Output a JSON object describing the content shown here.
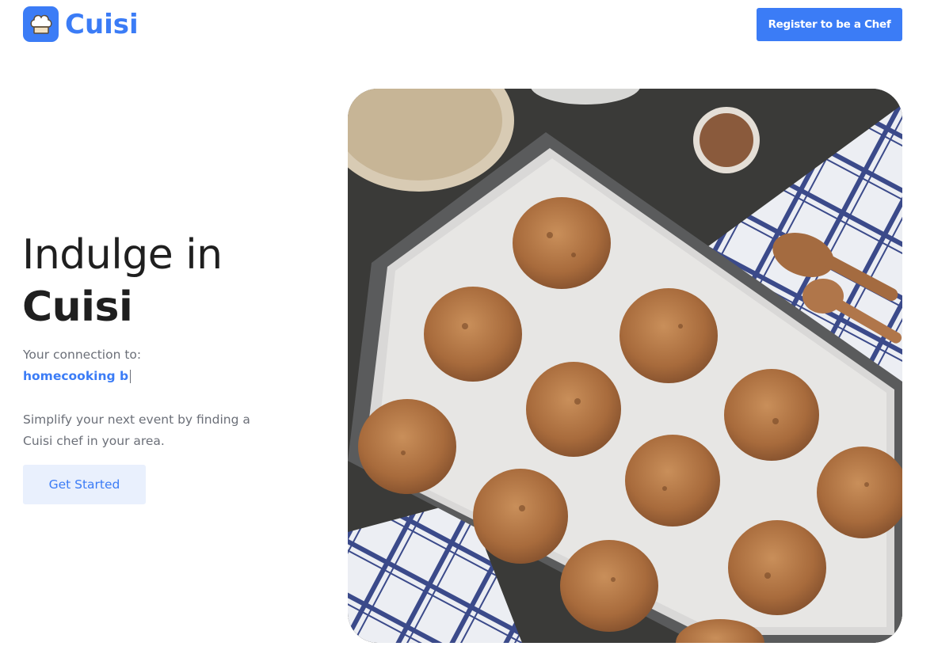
{
  "brand": {
    "name": "Cuisi",
    "icon": "chef-hat-icon",
    "color": "#3b7cf6"
  },
  "header": {
    "register_label": "Register to be a Chef"
  },
  "hero": {
    "title_line1": "Indulge in",
    "title_line2": "Cuisi",
    "connection_label": "Your connection to:",
    "typed_text": "homecooking b",
    "description": "Simplify your next event by finding a Cuisi chef in your area.",
    "cta_label": "Get Started"
  },
  "colors": {
    "accent": "#3b7cf6",
    "accent_light": "#e9f0fd",
    "muted_text": "#6b6f78"
  }
}
